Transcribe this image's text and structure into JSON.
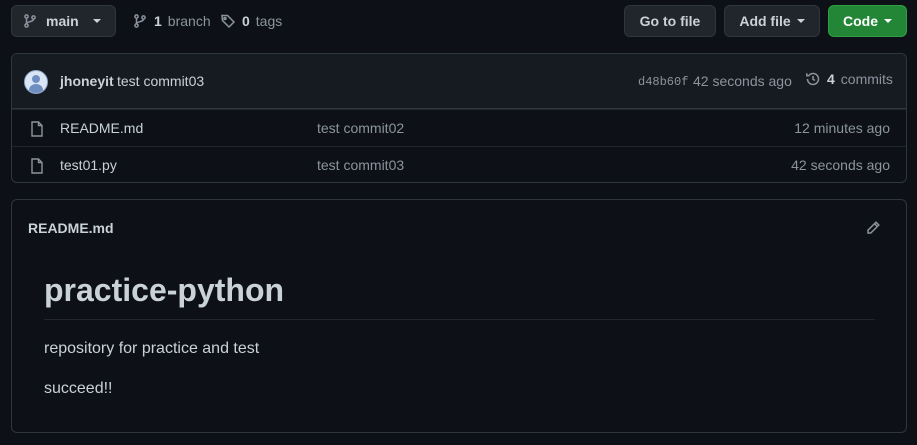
{
  "branch": {
    "name": "main"
  },
  "meta": {
    "branches_count": "1",
    "branches_label": "branch",
    "tags_count": "0",
    "tags_label": "tags"
  },
  "actions": {
    "go_to_file": "Go to file",
    "add_file": "Add file",
    "code": "Code"
  },
  "latest_commit": {
    "author": "jhoneyit",
    "message": "test commit03",
    "sha": "d48b60f",
    "time": "42 seconds ago",
    "commits_count": "4",
    "commits_label": "commits"
  },
  "files": [
    {
      "name": "README.md",
      "commit": "test commit02",
      "age": "12 minutes ago"
    },
    {
      "name": "test01.py",
      "commit": "test commit03",
      "age": "42 seconds ago"
    }
  ],
  "readme": {
    "filename": "README.md",
    "heading": "practice-python",
    "paragraphs": [
      "repository for practice and test",
      "succeed!!"
    ]
  },
  "colors": {
    "background": "#0d1117",
    "primary_button": "#238636",
    "border": "#30363d"
  },
  "icons": [
    "branch-icon",
    "tag-icon",
    "history-icon",
    "file-icon",
    "pencil-icon"
  ]
}
